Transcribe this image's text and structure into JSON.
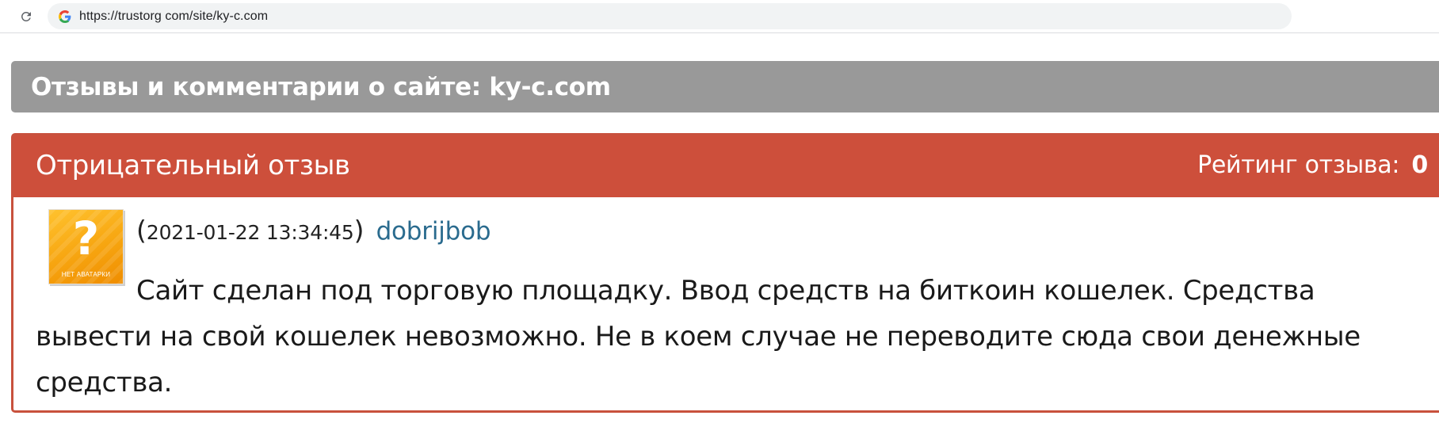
{
  "browser": {
    "url": "https://trustorg com/site/ky-c.com"
  },
  "page": {
    "title": "Отзывы и комментарии о сайте: ky-c.com"
  },
  "review": {
    "type": "Отрицательный отзыв",
    "rating_label": "Рейтинг отзыва:",
    "rating_value": "0",
    "avatar": {
      "symbol": "?",
      "caption": "НЕТ АВАТАРКИ"
    },
    "paren_open": "(",
    "date": "2021-01-22 13:34:45",
    "paren_close": ")",
    "author": "dobrijbob",
    "text": "Сайт сделан под торговую площадку. Ввод средств на биткоин кошелек. Средства вывести на свой кошелек невозможно. Не в коем случае не переводите сюда свои денежные средства."
  },
  "colors": {
    "title_bar": "#999999",
    "review_header": "#cd4f3b",
    "author_link": "#2a6b8e"
  }
}
